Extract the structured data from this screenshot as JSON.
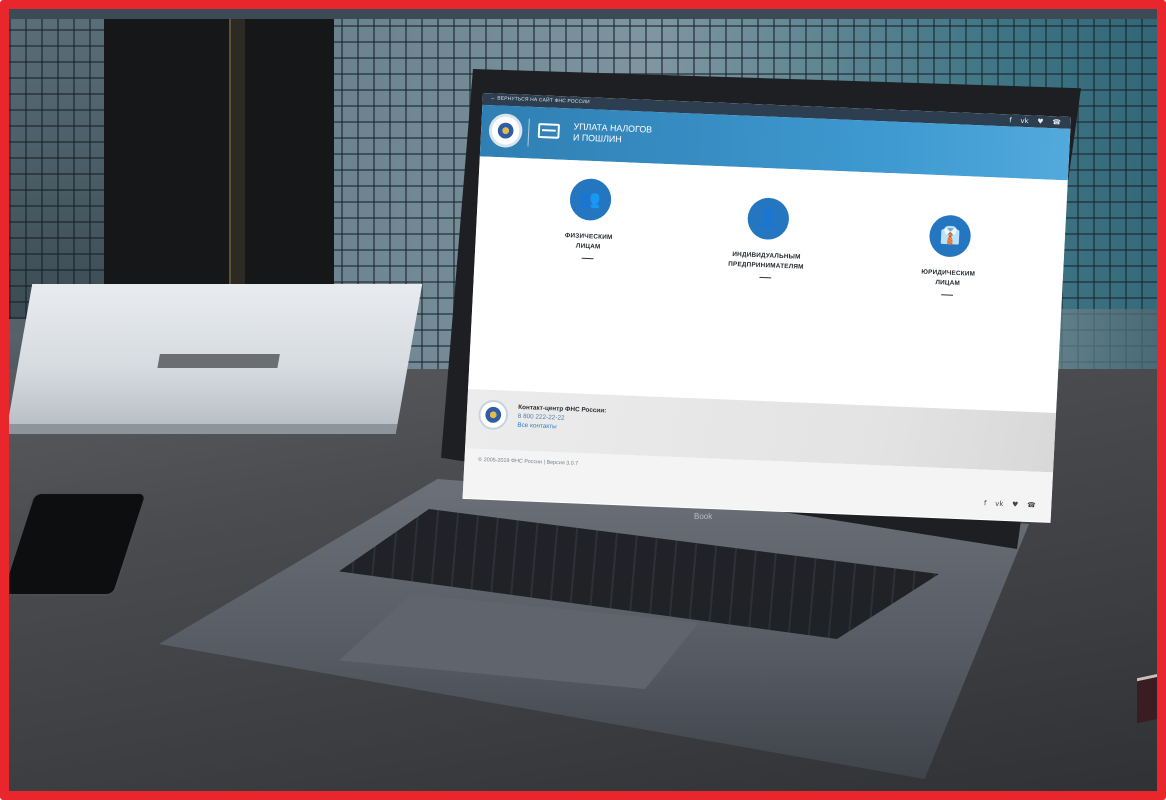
{
  "site": {
    "back_link": "← ВЕРНУТЬСЯ НА САЙТ ФНС РОССИИ",
    "title_line1": "УПЛАТА НАЛОГОВ",
    "title_line2": "И ПОШЛИН",
    "header_social": [
      "f",
      "vk",
      "tw",
      "phone"
    ],
    "categories": [
      {
        "line1": "ФИЗИЧЕСКИМ",
        "line2": "ЛИЦАМ",
        "icon": "users-icon"
      },
      {
        "line1": "ИНДИВИДУАЛЬНЫМ",
        "line2": "ПРЕДПРИНИМАТЕЛЯМ",
        "icon": "user-icon"
      },
      {
        "line1": "ЮРИДИЧЕСКИМ",
        "line2": "ЛИЦАМ",
        "icon": "business-user-icon"
      }
    ],
    "footer": {
      "contact_heading": "Контакт-центр ФНС России:",
      "phone": "8 800 222-22-22",
      "contacts_link": "Все контакты",
      "copyright": "© 2005-2019 ФНС России | Версия 3.0.7",
      "social": [
        "f",
        "vk",
        "tw",
        "phone"
      ]
    }
  },
  "laptop": {
    "brand": "Book"
  },
  "colors": {
    "frame": "#e8262b",
    "header": "#3e9ad1",
    "category_circle": "#2576c0"
  }
}
